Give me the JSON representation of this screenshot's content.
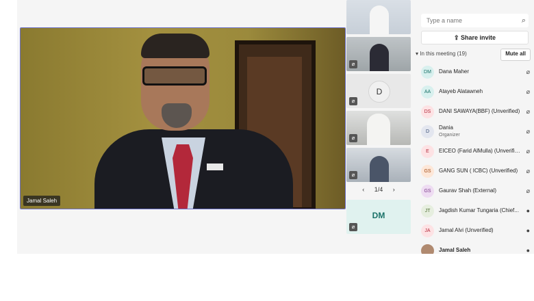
{
  "main_video": {
    "speaker_name": "Jamal Saleh"
  },
  "thumbnails": {
    "avatars": [
      {
        "initials": "D"
      },
      {
        "initials": "DM"
      }
    ],
    "pager": {
      "prev": "‹",
      "label": "1/4",
      "next": "›"
    }
  },
  "panel": {
    "search_placeholder": "Type a name",
    "share_label": "Share invite",
    "section_label": "In this meeting (19)",
    "mute_all_label": "Mute all",
    "participants": [
      {
        "initials": "DM",
        "name": "Dana Maher",
        "role": "",
        "mic": "muted",
        "color": "#d8f0ee",
        "text_color": "#1a7268"
      },
      {
        "initials": "AA",
        "name": "Atayeb Alatawneh",
        "role": "",
        "mic": "muted",
        "color": "#d8f0ee",
        "text_color": "#1a7268"
      },
      {
        "initials": "DS",
        "name": "DANI SAWAYA(BBF) (Unverified)",
        "role": "",
        "mic": "muted",
        "color": "#fde2e4",
        "text_color": "#b4283a"
      },
      {
        "initials": "D",
        "name": "Dania",
        "role": "Organizer",
        "mic": "muted",
        "color": "#e3e6ef",
        "text_color": "#384b73"
      },
      {
        "initials": "E",
        "name": "EICEO (Farid AlMulla) (Unverified)",
        "role": "",
        "mic": "muted",
        "color": "#fde2e4",
        "text_color": "#b4283a"
      },
      {
        "initials": "GS",
        "name": "GANG SUN ( ICBC) (Unverified)",
        "role": "",
        "mic": "muted",
        "color": "#fde7d8",
        "text_color": "#a34a14"
      },
      {
        "initials": "GS",
        "name": "Gaurav Shah (External)",
        "role": "",
        "mic": "muted",
        "color": "#eedcf2",
        "text_color": "#7b3a8a"
      },
      {
        "initials": "JT",
        "name": "Jagdish Kumar Tungaria (Chief...",
        "role": "",
        "mic": "on",
        "color": "#e6eedf",
        "text_color": "#4b6b2e"
      },
      {
        "initials": "JA",
        "name": "Jamal Alvi (Unverified)",
        "role": "",
        "mic": "on",
        "color": "#fde2e4",
        "text_color": "#b4283a"
      },
      {
        "initials": "",
        "name": "Jamal Saleh",
        "role": "",
        "mic": "on",
        "color": "#b08a70",
        "text_color": "#ffffff"
      }
    ]
  }
}
